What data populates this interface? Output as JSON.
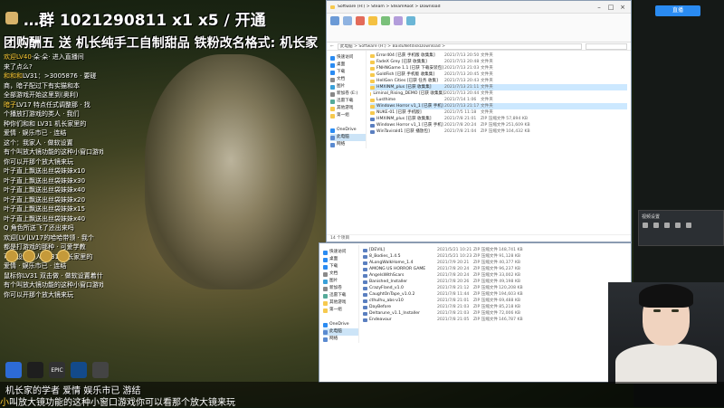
{
  "stream": {
    "banner_line1": "…群 1021290811  x1  x5 / 开通",
    "banner_line2": "团购酬五 送 机长纯手工自制甜品  铁粉改名格式: 机长家",
    "bottom_line1": "机长家的学者 爱情 娱乐市已 游结",
    "bottom_line2_user": "小",
    "bottom_line2_text": "叫放大镜功能的这种小窗口游戏你可以看那个放大镜来玩",
    "chat": [
      {
        "u": "欢迎LV40",
        "t": "·朵·朵· 进入直播间"
      },
      {
        "u": "",
        "t": "来了点么?"
      },
      {
        "u": "和和和",
        "t": "LV31：>3005876 · 要磋"
      },
      {
        "u": "",
        "t": "商，暗子配过下有实猫和本"
      },
      {
        "u": "",
        "t": "全部游戏开始这里到(奥利)"
      },
      {
        "u": "暗子",
        "t": "LV17 特点任式调整那 · 找"
      },
      {
        "u": "",
        "t": "个播放打游戏的类人 · 我们"
      },
      {
        "u": "",
        "t": "种你们和和 LV31 机长家里的"
      },
      {
        "u": "",
        "t": "爱情 · 娱乐市已 · 连结"
      },
      {
        "u": "",
        "t": "这个：我家人 · 做软设置"
      },
      {
        "u": "",
        "t": "有个叫放大镜功能的这种小窗口游戏"
      },
      {
        "u": "",
        "t": "你可以开那个放大镜来玩"
      },
      {
        "u": "",
        "t": "叶子直上飘送出丝袋妹妹x10"
      },
      {
        "u": "",
        "t": "叶子直上飘送出丝袋妹妹x30"
      },
      {
        "u": "",
        "t": "叶子直上飘送出丝袋妹妹x40"
      },
      {
        "u": "",
        "t": "叶子直上飘送出丝袋妹妹x20"
      },
      {
        "u": "",
        "t": "叶子直上飘送出丝袋妹妹x15"
      },
      {
        "u": "",
        "t": "叶子直上飘送出丝袋妹妹x40"
      },
      {
        "u": "",
        "t": "Q 角色所送飞了还出来吗"
      },
      {
        "u": "",
        "t": ""
      },
      {
        "u": "",
        "t": ""
      },
      {
        "u": "",
        "t": ""
      },
      {
        "u": "",
        "t": "欢迎[LV]LV17的哈哈带领 · 我个"
      },
      {
        "u": "",
        "t": "都是打游戏的那种 · 可爱学教"
      },
      {
        "u": "",
        "t": "可以设置家人 LV31 机长家里的"
      },
      {
        "u": "",
        "t": "爱情 · 娱乐市已 · 连结"
      },
      {
        "u": "",
        "t": "鼠标你LV31 双击做 · 做软设置着什"
      },
      {
        "u": "",
        "t": "有个叫放大镜功能的这种小窗口游戏"
      },
      {
        "u": "",
        "t": "你可以开那个放大镜来玩"
      }
    ]
  },
  "explorer_top": {
    "title": "Software (H:) > Steam > SteamRoot > Download",
    "address": "此电脑 > Software (H:) > BaiduNetdiskDownload >",
    "nav": [
      "快速访问",
      "桌面",
      "下载",
      "文档",
      "图片",
      "新加卷 (E:)",
      "迅雷下载",
      "其他游戏",
      "第一组",
      "",
      "OneDrive",
      "此电脑",
      "网络"
    ],
    "nav_selected": 11,
    "files": [
      {
        "name": "Error404 [已获 手机版 收集集]",
        "date": "2021/7/13 20:50",
        "type": "文件夹",
        "size": ""
      },
      {
        "name": "FadeX Grey [已获 收集集]",
        "date": "2021/7/13 20:48",
        "type": "文件夹",
        "size": ""
      },
      {
        "name": "FNHNGame 1.1 [已获 下载安装包]",
        "date": "2021/7/13 21:03",
        "type": "文件夹",
        "size": ""
      },
      {
        "name": "GoldFish [已获 手机版 收集集]",
        "date": "2021/7/13 20:45",
        "type": "文件夹",
        "size": ""
      },
      {
        "name": "HellGen Cities [已获 任务 收集]",
        "date": "2021/7/13 20:43",
        "type": "文件夹",
        "size": ""
      },
      {
        "name": "HMXINM_plus [已获 收集集]",
        "date": "2021/7/13 21:11",
        "type": "文件夹",
        "size": ""
      },
      {
        "name": "Liminal_Rising_DEMO [已获 收集集]",
        "date": "2021/7/13 20:44",
        "type": "文件夹",
        "size": ""
      },
      {
        "name": "Lusthime",
        "date": "2021/7/14 1:06",
        "type": "文件夹",
        "size": ""
      },
      {
        "name": "Windows Horror v1_1 [已获 手机]",
        "date": "2021/7/13 21:17",
        "type": "文件夹",
        "size": ""
      },
      {
        "name": "NUKE-01 [已获 手机版]",
        "date": "2021/7/5 11:18",
        "type": "文件夹",
        "size": ""
      },
      {
        "name": "HMXINM_plus [已获 收集集]",
        "date": "2021/7/8 21:01",
        "type": "ZIP 压缩文件",
        "size": "57,894 KB"
      },
      {
        "name": "Windows Horror v1_1 [已获 手机]",
        "date": "2021/7/8 20:24",
        "type": "ZIP 压缩文件",
        "size": "251,609 KB"
      },
      {
        "name": "WinTavirald1 [已获 播放包]",
        "date": "2021/7/8 21:04",
        "type": "ZIP 压缩文件",
        "size": "104,432 KB"
      }
    ],
    "selected_rows": [
      5,
      8
    ],
    "status": "14 个项目"
  },
  "explorer_bottom": {
    "nav": [
      "快速访问",
      "桌面",
      "下载",
      "文档",
      "图片",
      "新加卷",
      "迅雷下载",
      "其他游戏",
      "第一组",
      "",
      "OneDrive",
      "此电脑",
      "网络"
    ],
    "nav_selected": 11,
    "files": [
      {
        "name": "[DEVIL]",
        "date": "2021/5/21 10:21",
        "type": "ZIP 压缩文件",
        "size": "148,741 KB"
      },
      {
        "name": "8_Bodies_1.4.5",
        "date": "2021/5/21 10:23",
        "type": "ZIP 压缩文件",
        "size": "91,128 KB"
      },
      {
        "name": "ALongWalkHome_1.4",
        "date": "2021/7/9 20:21",
        "type": "ZIP 压缩文件",
        "size": "40,377 KB"
      },
      {
        "name": "AMONG US HORROR GAME",
        "date": "2021/7/8 20:24",
        "type": "ZIP 压缩文件",
        "size": "96,237 KB"
      },
      {
        "name": "AngelsWithScars",
        "date": "2021/7/8 20:24",
        "type": "ZIP 压缩文件",
        "size": "33,002 KB"
      },
      {
        "name": "Banished_Installer",
        "date": "2021/7/8 20:26",
        "type": "ZIP 压缩文件",
        "size": "49,198 KB"
      },
      {
        "name": "CrazyFland_v1.0",
        "date": "2021/7/8 21:12",
        "type": "ZIP 压缩文件",
        "size": "120,208 KB"
      },
      {
        "name": "CaughtOnTape_v1.0.2",
        "date": "2021/7/8 11:44",
        "type": "ZIP 压缩文件",
        "size": "194,603 KB"
      },
      {
        "name": "cthulhu_abs-v10",
        "date": "2021/7/8 21:01",
        "type": "ZIP 压缩文件",
        "size": "69,488 KB"
      },
      {
        "name": "DayBefore",
        "date": "2021/7/8 21:03",
        "type": "ZIP 压缩文件",
        "size": "85,218 KB"
      },
      {
        "name": "Deltarune_v1.1_Installer",
        "date": "2021/7/8 21:03",
        "type": "ZIP 压缩文件",
        "size": "72,006 KB"
      },
      {
        "name": "Endeavour",
        "date": "2021/7/8 21:05",
        "type": "ZIP 压缩文件",
        "size": "146,787 KB"
      }
    ]
  },
  "widgets": {
    "live_button": "直播",
    "panel_title": "视频设置"
  },
  "colors": {
    "folder": "#f6c94e",
    "zip": "#5a7fc0",
    "selection": "#cce8ff",
    "accent": "#2a8bf2"
  }
}
